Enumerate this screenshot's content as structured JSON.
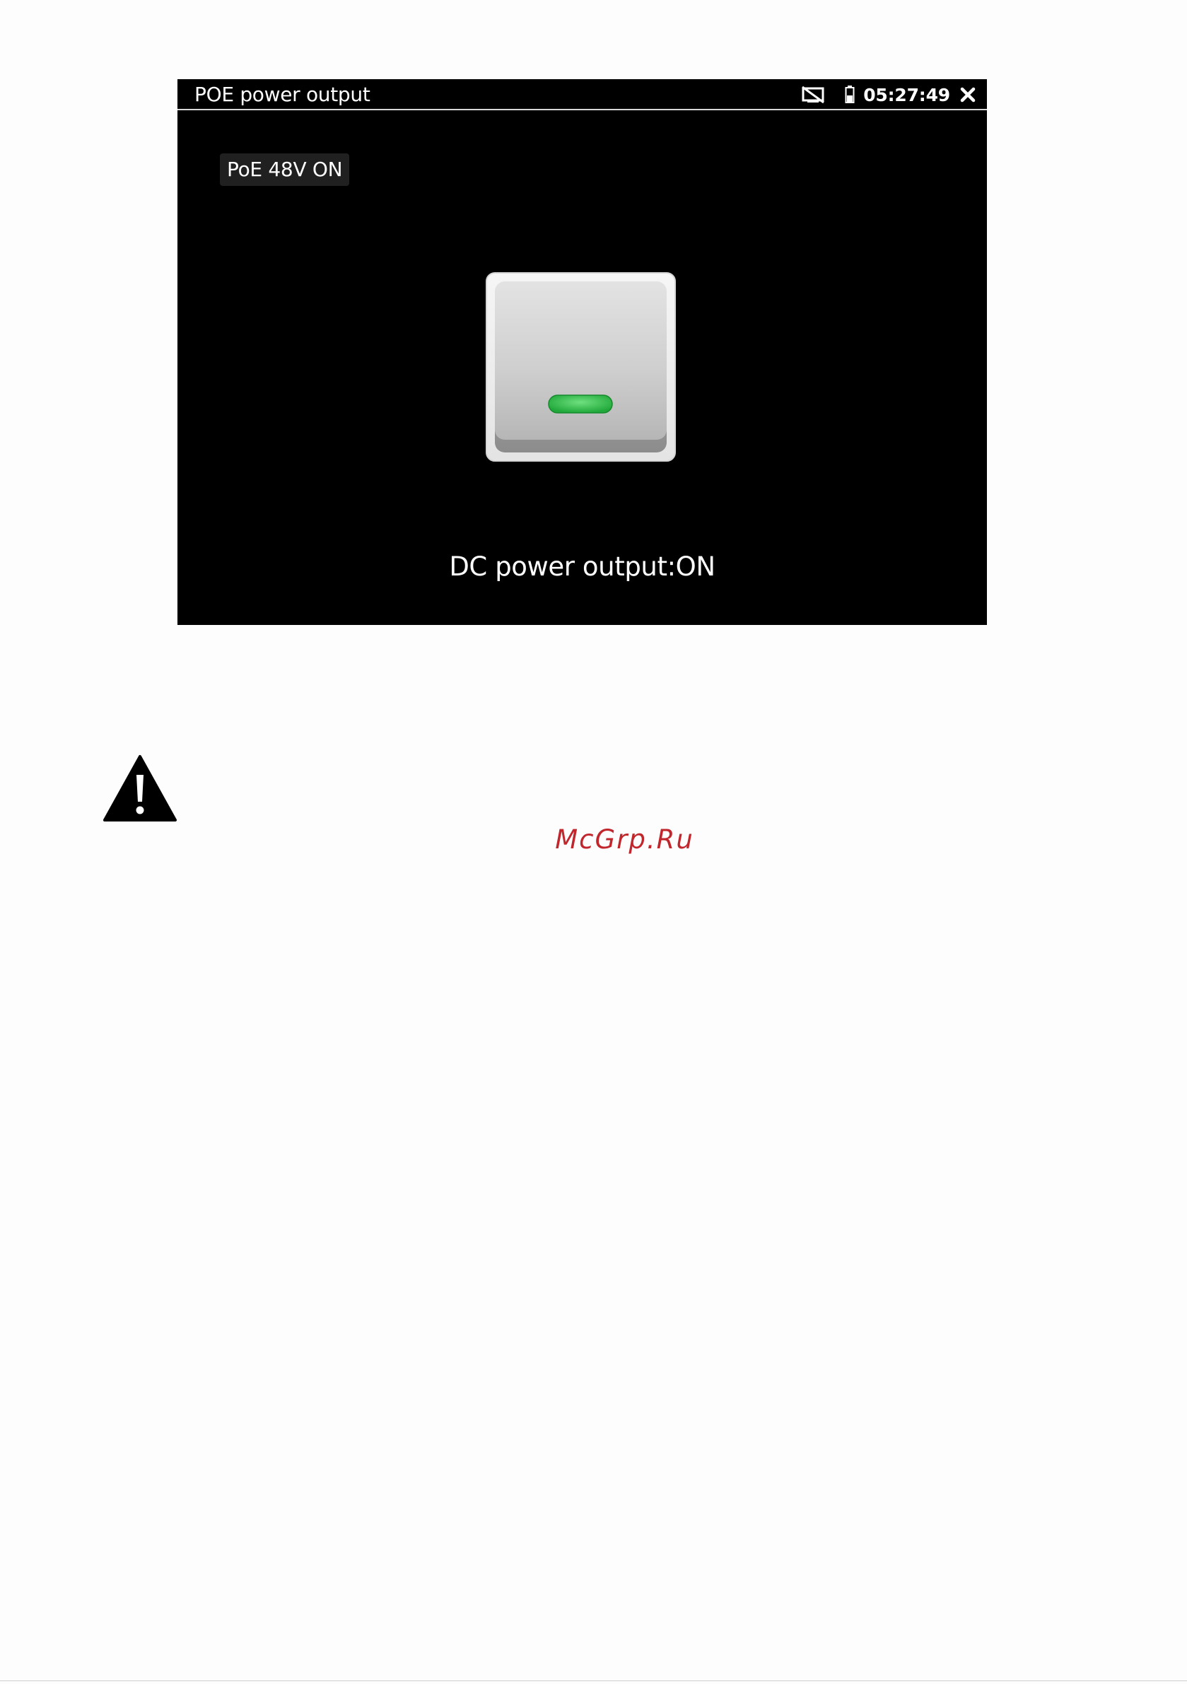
{
  "screen": {
    "title": "POE power output",
    "status": {
      "time": "05:27:49",
      "icons": [
        "no-display-icon",
        "battery-icon",
        "close-icon"
      ]
    },
    "poe_badge": "PoE 48V ON",
    "power_switch": {
      "state": "on",
      "indicator_color": "#2cb84a"
    },
    "dc_status": "DC power output:ON"
  },
  "page": {
    "warning_icon": "warning-icon",
    "watermark": "McGrp.Ru"
  },
  "colors": {
    "screen_background": "#000000",
    "watermark": "#c0262c",
    "indicator_on": "#2cb84a"
  }
}
